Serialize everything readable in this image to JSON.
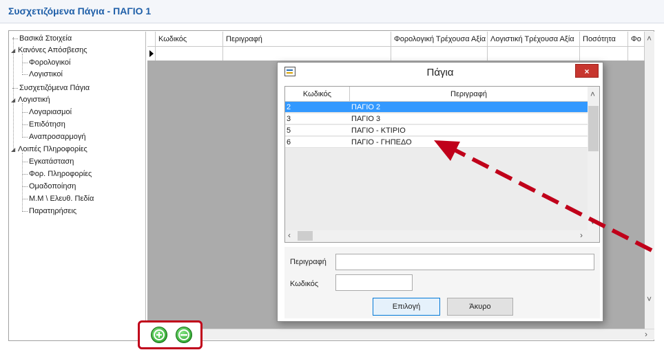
{
  "window": {
    "title": "Συσχετιζόμενα Πάγια - ΠΑΓΙΟ 1"
  },
  "tree": {
    "items": [
      {
        "label": "Βασικά Στοιχεία",
        "level": 0,
        "expander": false
      },
      {
        "label": "Κανόνες Απόσβεσης",
        "level": 0,
        "expander": true
      },
      {
        "label": "Φορολογικοί",
        "level": 1
      },
      {
        "label": "Λογιστικοί",
        "level": 1
      },
      {
        "label": "Συσχετιζόμενα Πάγια",
        "level": 0,
        "expander": false
      },
      {
        "label": "Λογιστική",
        "level": 0,
        "expander": true
      },
      {
        "label": "Λογαριασμοί",
        "level": 1
      },
      {
        "label": "Επιδότηση",
        "level": 1
      },
      {
        "label": "Αναπροσαρμογή",
        "level": 1
      },
      {
        "label": "Λοιπές Πληροφορίες",
        "level": 0,
        "expander": true
      },
      {
        "label": "Εγκατάσταση",
        "level": 1
      },
      {
        "label": "Φορ. Πληροφορίες",
        "level": 1
      },
      {
        "label": "Ομαδοποίηση",
        "level": 1
      },
      {
        "label": "Μ.Μ \\ Ελευθ. Πεδία",
        "level": 1
      },
      {
        "label": "Παρατηρήσεις",
        "level": 1
      }
    ]
  },
  "grid": {
    "columns": [
      "Κωδικός",
      "Περιγραφή",
      "Φορολογική Τρέχουσα Αξία",
      "Λογιστική Τρέχουσα Αξία",
      "Ποσότητα",
      "Φο"
    ]
  },
  "dialog": {
    "title": "Πάγια",
    "close_label": "×",
    "columns": [
      "Κωδικός",
      "Περιγραφή"
    ],
    "rows": [
      {
        "code": "2",
        "desc": "ΠΑΓΙΟ 2",
        "selected": true
      },
      {
        "code": "3",
        "desc": "ΠΑΓΙΟ 3",
        "selected": false
      },
      {
        "code": "5",
        "desc": "ΠΑΓΙΟ - ΚΤΙΡΙΟ",
        "selected": false
      },
      {
        "code": "6",
        "desc": "ΠΑΓΙΟ - ΓΗΠΕΔΟ",
        "selected": false
      }
    ],
    "description_label": "Περιγραφή",
    "description_value": "",
    "code_label": "Κωδικός",
    "code_value": "",
    "select_button": "Επιλογή",
    "cancel_button": "Άκυρο"
  },
  "toolbar": {
    "add_icon": "add-icon",
    "remove_icon": "remove-icon"
  },
  "colors": {
    "title": "#1f5fa8",
    "selection": "#3399ff",
    "highlight_frame": "#c0001a",
    "close": "#c7362f"
  }
}
